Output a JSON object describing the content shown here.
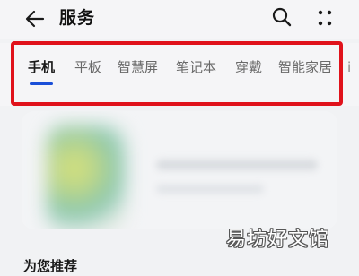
{
  "header": {
    "title": "服务",
    "back_icon": "arrow-left-icon",
    "search_icon": "search-icon",
    "more_icon": "more-dots-icon"
  },
  "tabs": [
    {
      "label": "手机",
      "active": true
    },
    {
      "label": "平板",
      "active": false
    },
    {
      "label": "智慧屏",
      "active": false
    },
    {
      "label": "笔记本",
      "active": false
    },
    {
      "label": "穿戴",
      "active": false
    },
    {
      "label": "智能家居",
      "active": false
    }
  ],
  "tabs_overflow": "i",
  "section": {
    "title": "为您推荐"
  },
  "watermark": "易坊好文馆",
  "colors": {
    "highlight_border": "#e0121b",
    "active_tab_underline": "#1a4fd8",
    "background": "#f1f2f4"
  }
}
